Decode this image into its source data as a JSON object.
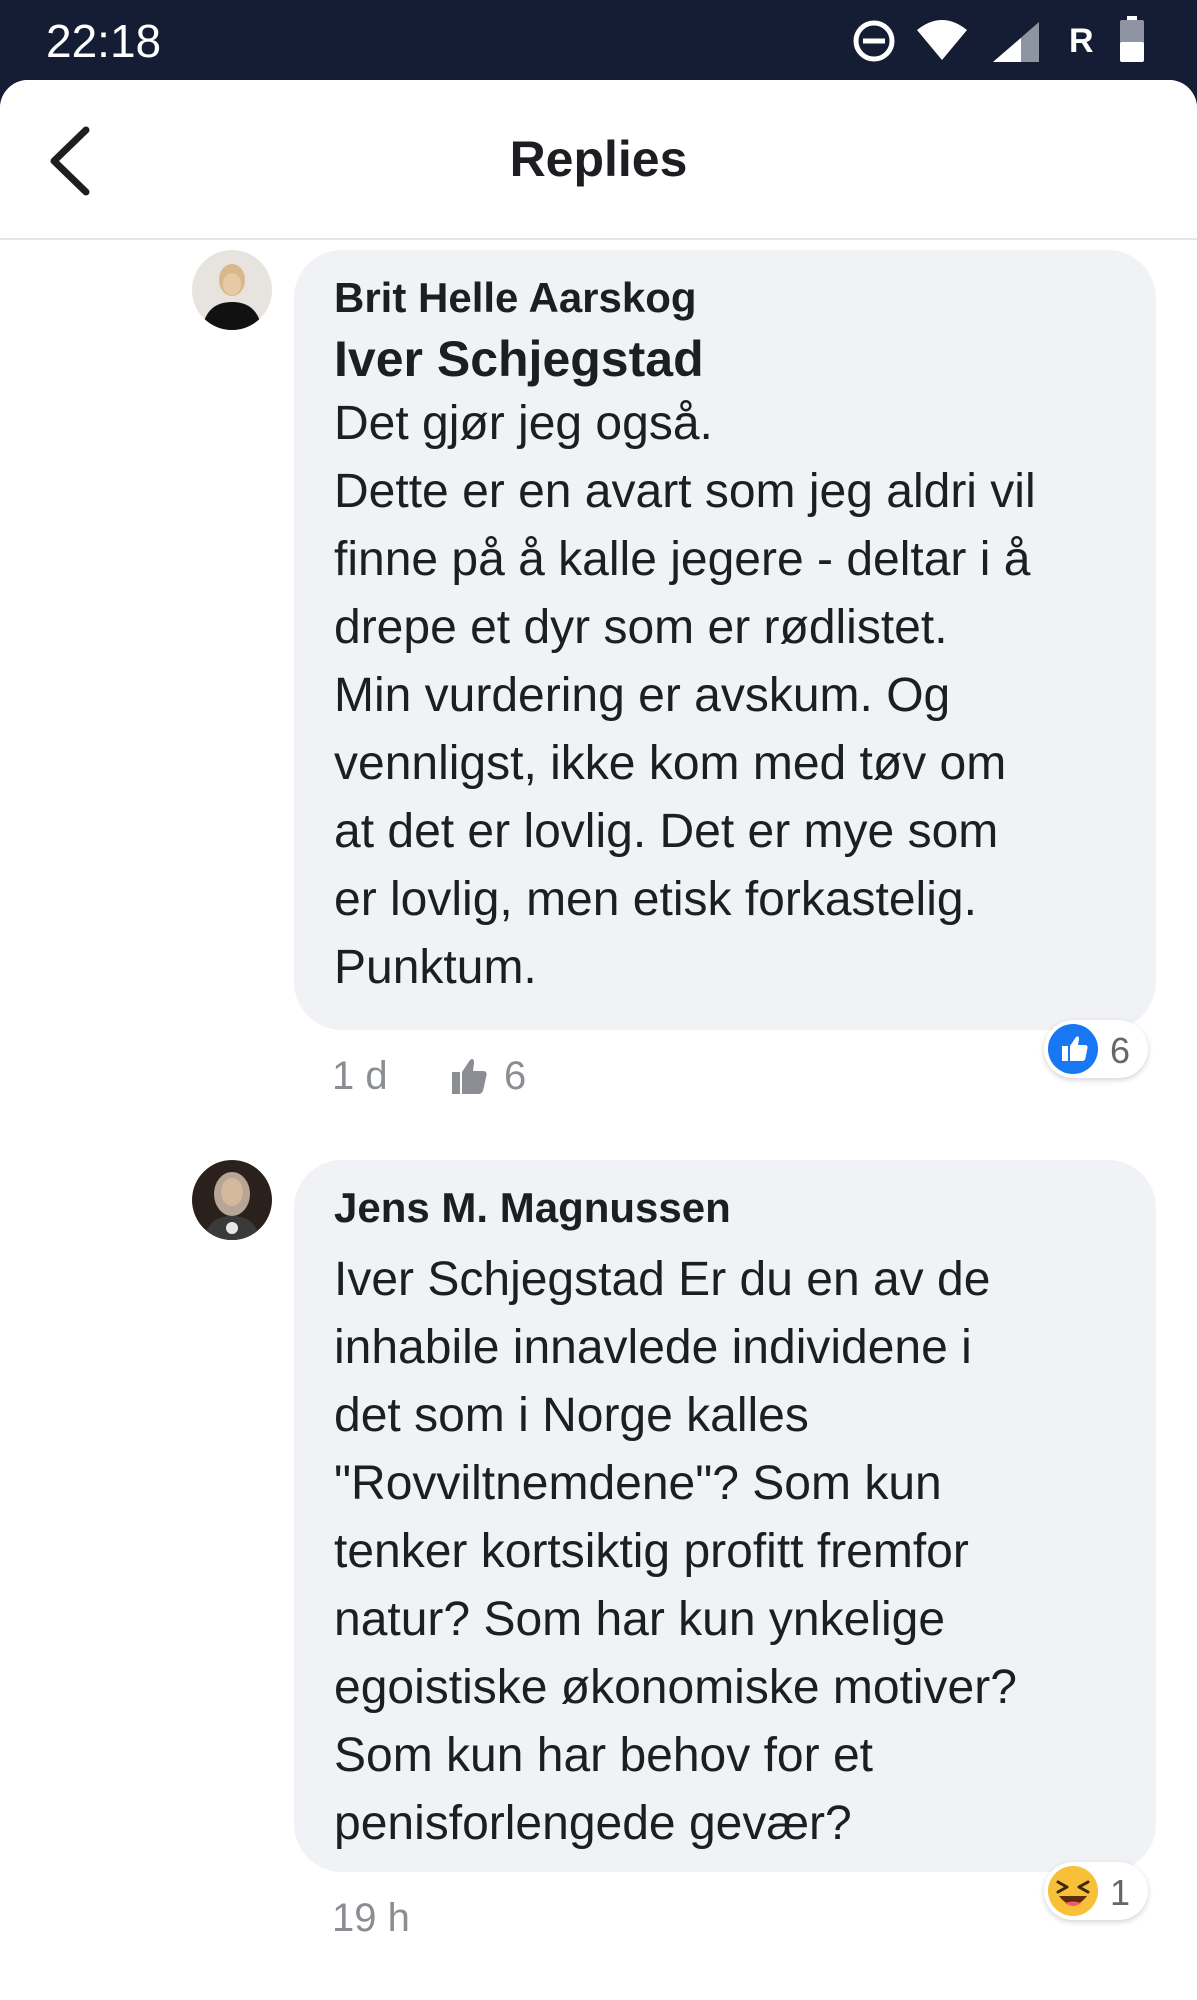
{
  "status_bar": {
    "time": "22:18",
    "carrier_letter": "R",
    "icons": [
      "do-not-disturb-icon",
      "wifi-icon",
      "signal-icon",
      "battery-icon"
    ]
  },
  "header": {
    "title": "Replies",
    "back_icon": "back-arrow-icon"
  },
  "comments": [
    {
      "author": "Brit Helle Aarskog",
      "mention": "Iver Schjegstad",
      "lines": [
        "Det gjør jeg også.",
        "Dette er en avart som jeg aldri vil",
        "finne på å kalle jegere - deltar i å",
        "drepe et dyr som er rødlistet.",
        "Min vurdering er avskum. Og",
        "vennligst, ikke kom med tøv om",
        "at det er lovlig. Det er mye som",
        "er lovlig, men etisk forkastelig.",
        "Punktum."
      ],
      "time": "1 d",
      "like_count": "6",
      "reaction": {
        "type": "like",
        "count": "6"
      }
    },
    {
      "author": "Jens M. Magnussen",
      "lines": [
        "Iver Schjegstad Er du en av de",
        "inhabile innavlede individene i",
        "det som i Norge kalles",
        "\"Rovviltnemdene\"? Som kun",
        "tenker kortsiktig profitt fremfor",
        "natur? Som har kun ynkelige",
        "egoistiske økonomiske motiver?",
        "Som kun har behov for et",
        "penisforlengede gevær?"
      ],
      "time": "19 h",
      "reaction": {
        "type": "haha",
        "count": "1"
      }
    }
  ],
  "colors": {
    "status_bar": "#141d33",
    "bubble": "#f0f2f5",
    "like_blue": "#1877f2",
    "meta_gray": "#8a8d91"
  }
}
